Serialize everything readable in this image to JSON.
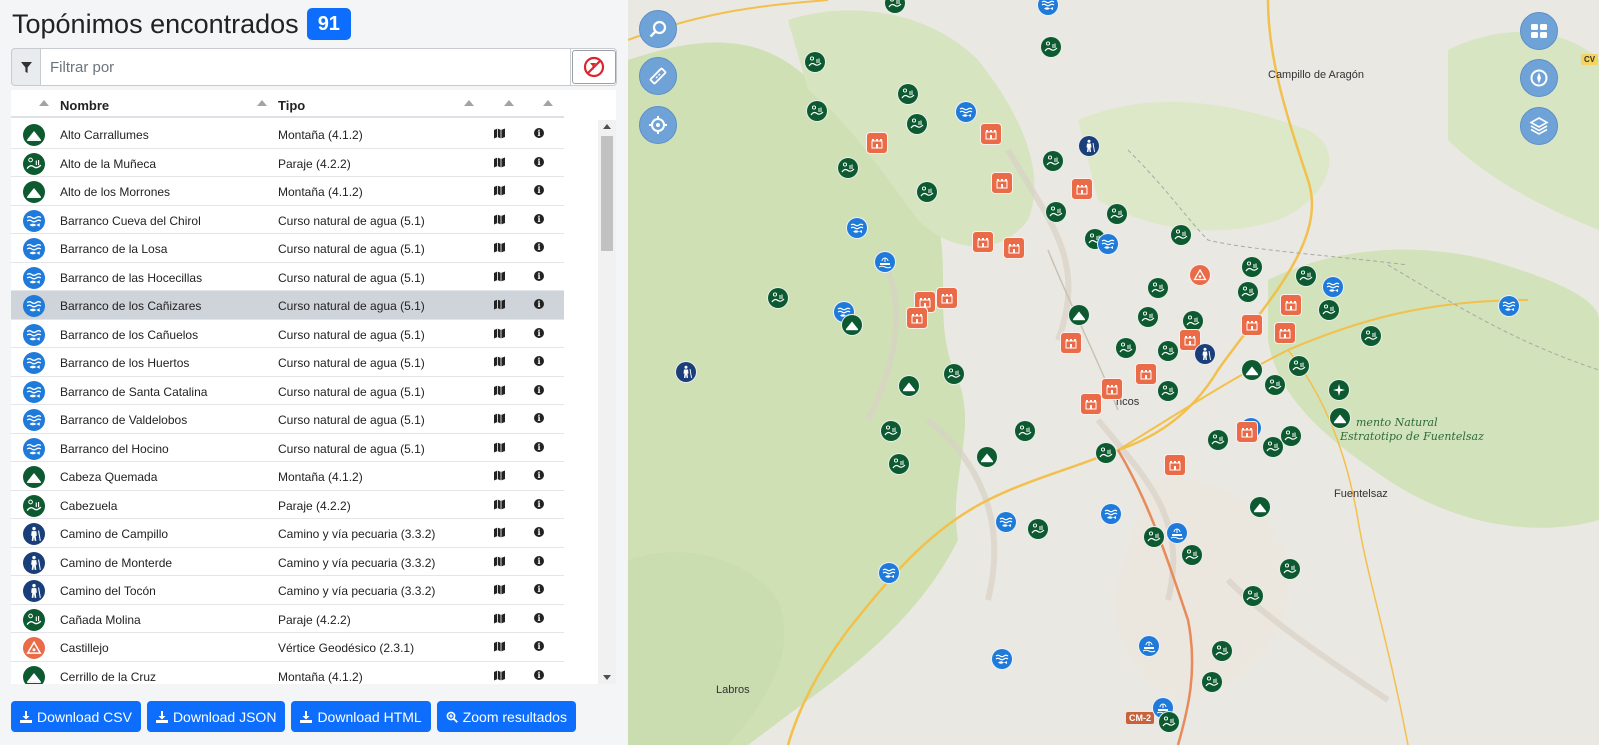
{
  "header": {
    "title": "Topónimos encontrados",
    "count": "91"
  },
  "filter": {
    "placeholder": "Filtrar por",
    "value": ""
  },
  "table": {
    "columns": {
      "name": "Nombre",
      "type": "Tipo"
    },
    "rows": [
      {
        "name": "Alto Carrallumes",
        "type": "Montaña (4.1.2)",
        "category": "montana",
        "selected": false
      },
      {
        "name": "Alto de la Muñeca",
        "type": "Paraje (4.2.2)",
        "category": "paraje",
        "selected": false
      },
      {
        "name": "Alto de los Morrones",
        "type": "Montaña (4.1.2)",
        "category": "montana",
        "selected": false
      },
      {
        "name": "Barranco Cueva del Chirol",
        "type": "Curso natural de agua (5.1)",
        "category": "agua",
        "selected": false
      },
      {
        "name": "Barranco de la Losa",
        "type": "Curso natural de agua (5.1)",
        "category": "agua",
        "selected": false
      },
      {
        "name": "Barranco de las Hocecillas",
        "type": "Curso natural de agua (5.1)",
        "category": "agua",
        "selected": false
      },
      {
        "name": "Barranco de los Cañizares",
        "type": "Curso natural de agua (5.1)",
        "category": "agua",
        "selected": true
      },
      {
        "name": "Barranco de los Cañuelos",
        "type": "Curso natural de agua (5.1)",
        "category": "agua",
        "selected": false
      },
      {
        "name": "Barranco de los Huertos",
        "type": "Curso natural de agua (5.1)",
        "category": "agua",
        "selected": false
      },
      {
        "name": "Barranco de Santa Catalina",
        "type": "Curso natural de agua (5.1)",
        "category": "agua",
        "selected": false
      },
      {
        "name": "Barranco de Valdelobos",
        "type": "Curso natural de agua (5.1)",
        "category": "agua",
        "selected": false
      },
      {
        "name": "Barranco del Hocino",
        "type": "Curso natural de agua (5.1)",
        "category": "agua",
        "selected": false
      },
      {
        "name": "Cabeza Quemada",
        "type": "Montaña (4.1.2)",
        "category": "montana",
        "selected": false
      },
      {
        "name": "Cabezuela",
        "type": "Paraje (4.2.2)",
        "category": "paraje",
        "selected": false
      },
      {
        "name": "Camino de Campillo",
        "type": "Camino y vía pecuaria (3.3.2)",
        "category": "camino",
        "selected": false
      },
      {
        "name": "Camino de Monterde",
        "type": "Camino y vía pecuaria (3.3.2)",
        "category": "camino",
        "selected": false
      },
      {
        "name": "Camino del Tocón",
        "type": "Camino y vía pecuaria (3.3.2)",
        "category": "camino",
        "selected": false
      },
      {
        "name": "Cañada Molina",
        "type": "Paraje (4.2.2)",
        "category": "paraje",
        "selected": false
      },
      {
        "name": "Castillejo",
        "type": "Vértice Geodésico (2.3.1)",
        "category": "vertice",
        "selected": false
      },
      {
        "name": "Cerrillo de la Cruz",
        "type": "Montaña (4.1.2)",
        "category": "montana",
        "selected": false
      }
    ]
  },
  "buttons": {
    "csv": "Download CSV",
    "json": "Download JSON",
    "html": "Download HTML",
    "zoom": "Zoom resultados"
  },
  "map": {
    "labels": {
      "campillo": "Campillo de Aragón",
      "labros": "Labros",
      "fuentelsaz": "Fuentelsaz",
      "town_center": "ncos",
      "monumento_line1": "mento Natural",
      "monumento_line2": "Estratotipo de Fuentelsaz",
      "road_cm": "CM-2",
      "road_cv": "CV"
    },
    "controls": [
      "search-map-icon",
      "ruler-icon",
      "locate-icon",
      "grid-icon",
      "compass-icon",
      "layers-icon"
    ]
  },
  "colors": {
    "accent": "#0d6efd",
    "paraje": "#0d5a31",
    "agua": "#1f7ad9",
    "camino": "#1a3e7a",
    "edificio": "#e96b48",
    "map_ctrl": "#6fa3d8"
  }
}
